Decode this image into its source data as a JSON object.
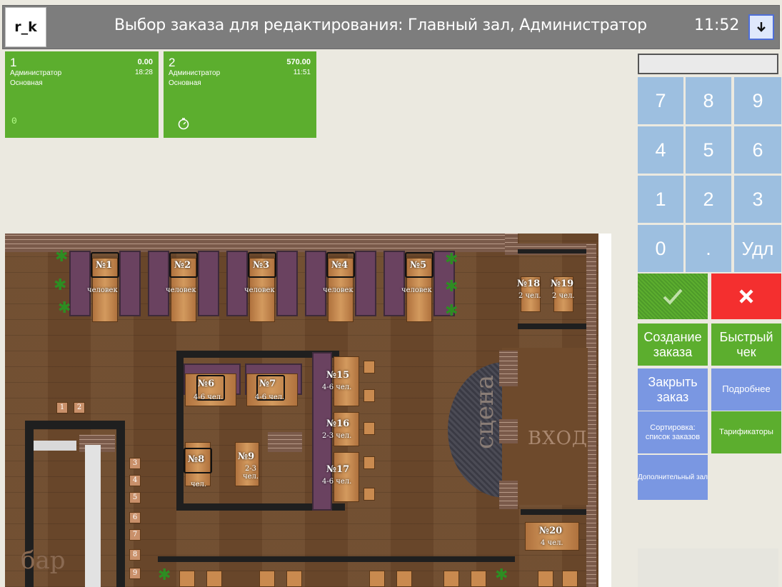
{
  "header": {
    "logo": "r_k",
    "title": "Выбор заказа для редактирования: Главный зал, Администратор",
    "time": "11:52",
    "menu_icon": "arrow-down-icon"
  },
  "orders": [
    {
      "number": "1",
      "sum": "0.00",
      "user": "Администратор",
      "time": "18:28",
      "hall": "Основная",
      "extra": "0"
    },
    {
      "number": "2",
      "sum": "570.00",
      "user": "Администратор",
      "time": "11:51",
      "hall": "Основная",
      "extra_icon": "timer-icon"
    }
  ],
  "floor": {
    "tables": [
      {
        "label": "№1",
        "sub": "человек"
      },
      {
        "label": "№2",
        "sub": "человек"
      },
      {
        "label": "№3",
        "sub": "человек"
      },
      {
        "label": "№4",
        "sub": "человек"
      },
      {
        "label": "№5",
        "sub": "человек"
      },
      {
        "label": "№6",
        "sub": "4-6 чел."
      },
      {
        "label": "№7",
        "sub": "4-6 чел."
      },
      {
        "label": "№8",
        "sub": "чел."
      },
      {
        "label": "№9",
        "sub": "2-3 чел."
      },
      {
        "label": "№15",
        "sub": "4-6 чел."
      },
      {
        "label": "№16",
        "sub": "2-3 чел."
      },
      {
        "label": "№17",
        "sub": "4-6 чел."
      },
      {
        "label": "№18",
        "sub": "2 чел."
      },
      {
        "label": "№19",
        "sub": "2 чел."
      },
      {
        "label": "№20",
        "sub": "4 чел."
      }
    ],
    "bar_seats": [
      "1",
      "2",
      "3",
      "4",
      "5",
      "6",
      "7",
      "8",
      "9"
    ],
    "scene_label": "сцена",
    "entrance_label": "ВХОД",
    "bar_label": "бар"
  },
  "keypad": {
    "keys": [
      "7",
      "8",
      "9",
      "4",
      "5",
      "6",
      "1",
      "2",
      "3",
      "0",
      ".",
      "Удл"
    ]
  },
  "actions": {
    "create_order": "Создание заказа",
    "quick_check": "Быстрый чек",
    "close_order": "Закрыть заказ",
    "details": "Подробнее",
    "sort": "Сортировка: список заказов",
    "tariffs": "Тарификаторы",
    "extra_hall": "Дополнительный зал"
  },
  "colors": {
    "green": "#5cae2e",
    "blue_key": "#9dbfe0",
    "blue_action": "#7a97e2",
    "red": "#f42f2f",
    "header": "#7d7d7d"
  }
}
